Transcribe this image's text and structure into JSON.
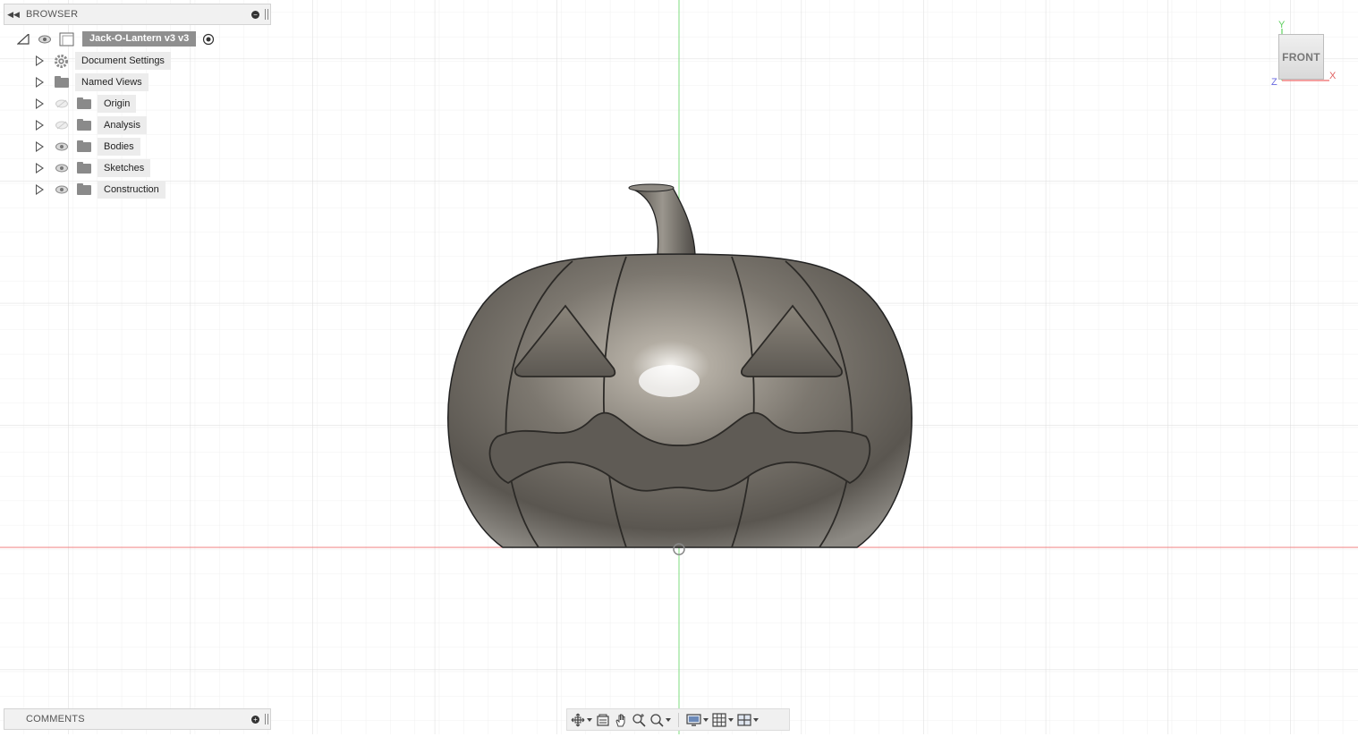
{
  "browser": {
    "header_title": "BROWSER",
    "root": {
      "label": "Jack-O-Lantern v3 v3"
    },
    "items": [
      {
        "label": "Document Settings",
        "icon": "gear-icon",
        "visibility": "none"
      },
      {
        "label": "Named Views",
        "icon": "folder-icon",
        "visibility": "none"
      },
      {
        "label": "Origin",
        "icon": "folder-icon",
        "visibility": "hidden"
      },
      {
        "label": "Analysis",
        "icon": "folder-icon",
        "visibility": "hidden"
      },
      {
        "label": "Bodies",
        "icon": "folder-icon",
        "visibility": "visible"
      },
      {
        "label": "Sketches",
        "icon": "folder-icon",
        "visibility": "visible"
      },
      {
        "label": "Construction",
        "icon": "folder-icon",
        "visibility": "visible"
      }
    ]
  },
  "comments": {
    "header_title": "COMMENTS"
  },
  "viewcube": {
    "face_label": "FRONT",
    "axis_y": "Y",
    "axis_x": "X",
    "axis_z": "Z"
  },
  "navbar": {
    "buttons": [
      "orbit-icon",
      "look-at-icon",
      "pan-icon",
      "zoom-icon",
      "fit-icon",
      "display-settings-icon",
      "grid-settings-icon",
      "viewports-icon"
    ]
  },
  "colors": {
    "grid_minor": "#f0f0f0",
    "grid_major": "#d9d9d9",
    "axis_green": "#7fdc7f",
    "axis_red": "#f08080",
    "body_gray": "#6e6a63"
  }
}
